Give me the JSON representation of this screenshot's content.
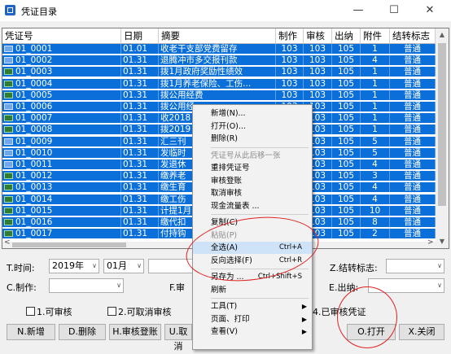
{
  "window": {
    "title": "凭证目录",
    "minimize": "—",
    "maximize": "☐",
    "close": "✕"
  },
  "grid": {
    "headers": [
      "凭证号",
      "日期",
      "摘要",
      "制作",
      "审核",
      "出纳",
      "附件",
      "结转标志"
    ],
    "rows": [
      {
        "no": "01_0001",
        "date": "01.01",
        "summary": "收老干支部党费留存",
        "maker": "103",
        "auditor": "103",
        "cashier": "105",
        "att": "1",
        "flag": "普通",
        "icon": "blue-doc-icon"
      },
      {
        "no": "01_0002",
        "date": "01.31",
        "summary": "退腾冲市多交报刊款",
        "maker": "103",
        "auditor": "103",
        "cashier": "105",
        "att": "4",
        "flag": "普通",
        "icon": "blue-doc-icon"
      },
      {
        "no": "01_0003",
        "date": "01.31",
        "summary": "拨1月政府奖励性绩效",
        "maker": "103",
        "auditor": "103",
        "cashier": "105",
        "att": "1",
        "flag": "普通",
        "icon": "green-doc-icon"
      },
      {
        "no": "01_0004",
        "date": "01.31",
        "summary": "拨1月养老保险、工伤...",
        "maker": "103",
        "auditor": "103",
        "cashier": "105",
        "att": "1",
        "flag": "普通",
        "icon": "green-doc-icon"
      },
      {
        "no": "01_0005",
        "date": "01.31",
        "summary": "拨公用经费",
        "maker": "103",
        "auditor": "103",
        "cashier": "105",
        "att": "1",
        "flag": "普通",
        "icon": "green-doc-icon"
      },
      {
        "no": "01_0006",
        "date": "01.31",
        "summary": "拨公用经",
        "maker": "103",
        "auditor": "103",
        "cashier": "105",
        "att": "1",
        "flag": "普通",
        "icon": "blue-doc-icon"
      },
      {
        "no": "01_0007",
        "date": "01.31",
        "summary": "收2018",
        "maker": "103",
        "auditor": "103",
        "cashier": "105",
        "att": "1",
        "flag": "普通",
        "icon": "green-doc-icon"
      },
      {
        "no": "01_0008",
        "date": "01.31",
        "summary": "拨2019",
        "maker": "103",
        "auditor": "103",
        "cashier": "105",
        "att": "1",
        "flag": "普通",
        "icon": "green-doc-icon"
      },
      {
        "no": "01_0009",
        "date": "01.31",
        "summary": "汇三刊",
        "maker": "103",
        "auditor": "103",
        "cashier": "105",
        "att": "5",
        "flag": "普通",
        "icon": "blue-doc-icon"
      },
      {
        "no": "01_0010",
        "date": "01.31",
        "summary": "发临时",
        "maker": "103",
        "auditor": "103",
        "cashier": "105",
        "att": "5",
        "flag": "普通",
        "icon": "blue-doc-icon"
      },
      {
        "no": "01_0011",
        "date": "01.31",
        "summary": "发退休",
        "maker": "103",
        "auditor": "103",
        "cashier": "105",
        "att": "4",
        "flag": "普通",
        "icon": "blue-doc-icon"
      },
      {
        "no": "01_0012",
        "date": "01.31",
        "summary": "缴养老",
        "maker": "103",
        "auditor": "103",
        "cashier": "105",
        "att": "3",
        "flag": "普通",
        "icon": "green-doc-icon"
      },
      {
        "no": "01_0013",
        "date": "01.31",
        "summary": "缴生育",
        "maker": "103",
        "auditor": "103",
        "cashier": "105",
        "att": "4",
        "flag": "普通",
        "icon": "green-doc-icon"
      },
      {
        "no": "01_0014",
        "date": "01.31",
        "summary": "缴工伤",
        "maker": "103",
        "auditor": "103",
        "cashier": "105",
        "att": "4",
        "flag": "普通",
        "icon": "green-doc-icon"
      },
      {
        "no": "01_0015",
        "date": "01.31",
        "summary": "计提1月",
        "maker": "103",
        "auditor": "103",
        "cashier": "105",
        "att": "10",
        "flag": "普通",
        "icon": "green-doc-icon"
      },
      {
        "no": "01_0016",
        "date": "01.31",
        "summary": "缴代扣",
        "maker": "103",
        "auditor": "103",
        "cashier": "105",
        "att": "8",
        "flag": "普通",
        "icon": "green-doc-icon"
      },
      {
        "no": "01_0017",
        "date": "01.31",
        "summary": "付持钩",
        "maker": "103",
        "auditor": "103",
        "cashier": "105",
        "att": "2",
        "flag": "普通",
        "icon": "green-doc-icon"
      }
    ]
  },
  "filters": {
    "time_label": "T.时间:",
    "year": "2019年",
    "month": "01月",
    "maker_label": "C.制作:",
    "auditor_label": "F.审",
    "carry_label": "Z.结转标志:",
    "cashier_label": "E.出纳:",
    "checks": [
      "1.可审核",
      "2.可取消审核",
      "4.已审核凭证"
    ]
  },
  "buttons": {
    "new": "N.新增",
    "delete": "D.删除",
    "audit": "H.审核登账",
    "cancel": "U.取消",
    "open": "O.打开",
    "close": "X.关闭"
  },
  "menu": {
    "items": [
      {
        "label": "新增(N)...",
        "shortcut": "",
        "state": "normal"
      },
      {
        "label": "打开(O)...",
        "shortcut": "",
        "state": "normal"
      },
      {
        "label": "删除(R)",
        "shortcut": "",
        "state": "normal"
      },
      {
        "label": "凭证号从此后移一张",
        "shortcut": "",
        "state": "disabled"
      },
      {
        "label": "重排凭证号",
        "shortcut": "",
        "state": "normal"
      },
      {
        "label": "审核登账",
        "shortcut": "",
        "state": "normal"
      },
      {
        "label": "取消审核",
        "shortcut": "",
        "state": "normal"
      },
      {
        "label": "现金流量表 ...",
        "shortcut": "",
        "state": "normal"
      },
      {
        "label": "复制(C)",
        "shortcut": "",
        "state": "normal"
      },
      {
        "label": "粘贴(P)",
        "shortcut": "",
        "state": "disabled"
      },
      {
        "label": "全选(A)",
        "shortcut": "Ctrl+A",
        "state": "highlighted"
      },
      {
        "label": "反向选择(F)",
        "shortcut": "Ctrl+R",
        "state": "normal"
      },
      {
        "label": "另存为 ...",
        "shortcut": "Ctrl+Shift+S",
        "state": "normal"
      },
      {
        "label": "刷新",
        "shortcut": "",
        "state": "normal"
      },
      {
        "label": "工具(T)",
        "shortcut": "",
        "state": "submenu"
      },
      {
        "label": "页面、打印",
        "shortcut": "",
        "state": "submenu"
      },
      {
        "label": "查看(V)",
        "shortcut": "",
        "state": "submenu"
      }
    ]
  },
  "colors": {
    "selection": "#0a6fd8",
    "annotation": "#e02020",
    "menu_highlight": "#cfe3f8"
  }
}
